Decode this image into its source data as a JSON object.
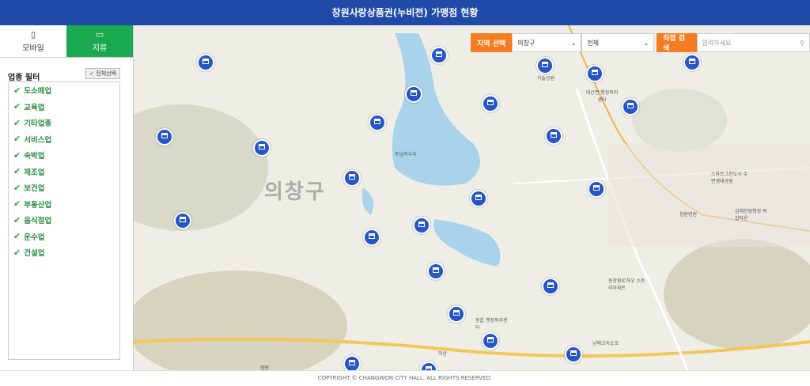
{
  "header": {
    "title": "창원사랑상품권(누비전) 가맹점 현황"
  },
  "tabs": [
    {
      "label": "모바일",
      "icon": "mobile-icon"
    },
    {
      "label": "지류",
      "icon": "paper-voucher-icon"
    }
  ],
  "filter": {
    "title": "업종 필터",
    "select_all": "전체선택",
    "items": [
      "도소매업",
      "교육업",
      "기타업종",
      "서비스업",
      "숙박업",
      "제조업",
      "보건업",
      "부동산업",
      "음식점업",
      "운수업",
      "건설업"
    ]
  },
  "search": {
    "region_label": "지역 선택",
    "district": "의창구",
    "dong": "전체",
    "direct_label": "직접 검색",
    "placeholder": "입력하세요."
  },
  "map": {
    "district_label": "의창구",
    "reservoir": "주남저수지",
    "labels": [
      "가술공원",
      "대산면 행정복지센터",
      "스마트그린도시 수변생태공원",
      "창원병원",
      "김해한림행정 복합타운",
      "동창원IC하우 스토리아파트",
      "동읍 행정복지센터",
      "남해고속도로",
      "창원",
      "덕산"
    ]
  },
  "colors": {
    "header": "#1f4aa8",
    "tab_active": "#1aa94f",
    "accent": "#f57c1f",
    "pin": "#2656c8"
  },
  "footer": {
    "text": "COPYRIGHT ©  CHANGWON CITY HALL. ALL RIGHTS RESERVED."
  }
}
